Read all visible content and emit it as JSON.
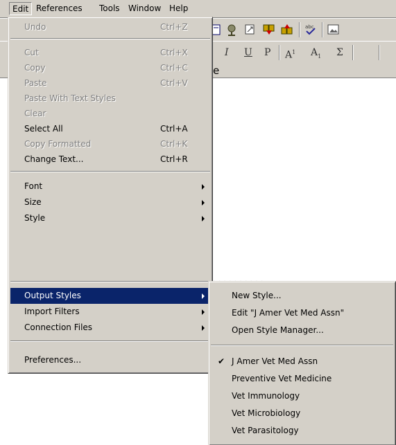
{
  "menubar": {
    "items": [
      {
        "label": "Edit"
      },
      {
        "label": "References"
      },
      {
        "label": "Tools"
      },
      {
        "label": "Window"
      },
      {
        "label": "Help"
      }
    ]
  },
  "toolbar1": {
    "icons": [
      "document-icon",
      "globe-pin-icon",
      "link-document-icon",
      "insert-citation-icon",
      "format-bibliography-icon",
      "spellcheck-icon",
      "image-icon"
    ]
  },
  "toolbar2": {
    "italic": "I",
    "underline": "U",
    "plain": "P",
    "superscript": "A",
    "superscript_mark": "1",
    "subscript": "A",
    "subscript_mark": "1",
    "symbol": "Σ"
  },
  "header_fragment": "e",
  "doc_fragment": "· · · · · · · · · ·",
  "edit_menu": {
    "undo": {
      "label": "Undo",
      "shortcut": "Ctrl+Z"
    },
    "cut": {
      "label": "Cut",
      "shortcut": "Ctrl+X"
    },
    "copy": {
      "label": "Copy",
      "shortcut": "Ctrl+C"
    },
    "paste": {
      "label": "Paste",
      "shortcut": "Ctrl+V"
    },
    "paste_styles": {
      "label": "Paste With Text Styles"
    },
    "clear": {
      "label": "Clear"
    },
    "select_all": {
      "label": "Select All",
      "shortcut": "Ctrl+A"
    },
    "copy_formatted": {
      "label": "Copy Formatted",
      "shortcut": "Ctrl+K"
    },
    "change_text": {
      "label": "Change Text...",
      "shortcut": "Ctrl+R"
    },
    "font": {
      "label": "Font"
    },
    "size": {
      "label": "Size"
    },
    "style": {
      "label": "Style"
    },
    "output_styles": {
      "label": "Output Styles"
    },
    "import_filters": {
      "label": "Import Filters"
    },
    "connection_files": {
      "label": "Connection Files"
    },
    "preferences": {
      "label": "Preferences..."
    }
  },
  "output_styles_menu": {
    "new_style": "New Style...",
    "edit_style": "Edit \"J Amer Vet Med Assn\"",
    "open_manager": "Open Style Manager...",
    "styles": [
      {
        "label": "J Amer Vet Med Assn",
        "checked": true
      },
      {
        "label": "Preventive Vet Medicine",
        "checked": false
      },
      {
        "label": "Vet Immunology",
        "checked": false
      },
      {
        "label": "Vet Microbiology",
        "checked": false
      },
      {
        "label": "Vet Parasitology",
        "checked": false
      }
    ],
    "check_mark": "✔"
  },
  "colors": {
    "menu_face": "#d4d0c8",
    "highlight": "#0a246a",
    "disabled_text": "#808080"
  }
}
